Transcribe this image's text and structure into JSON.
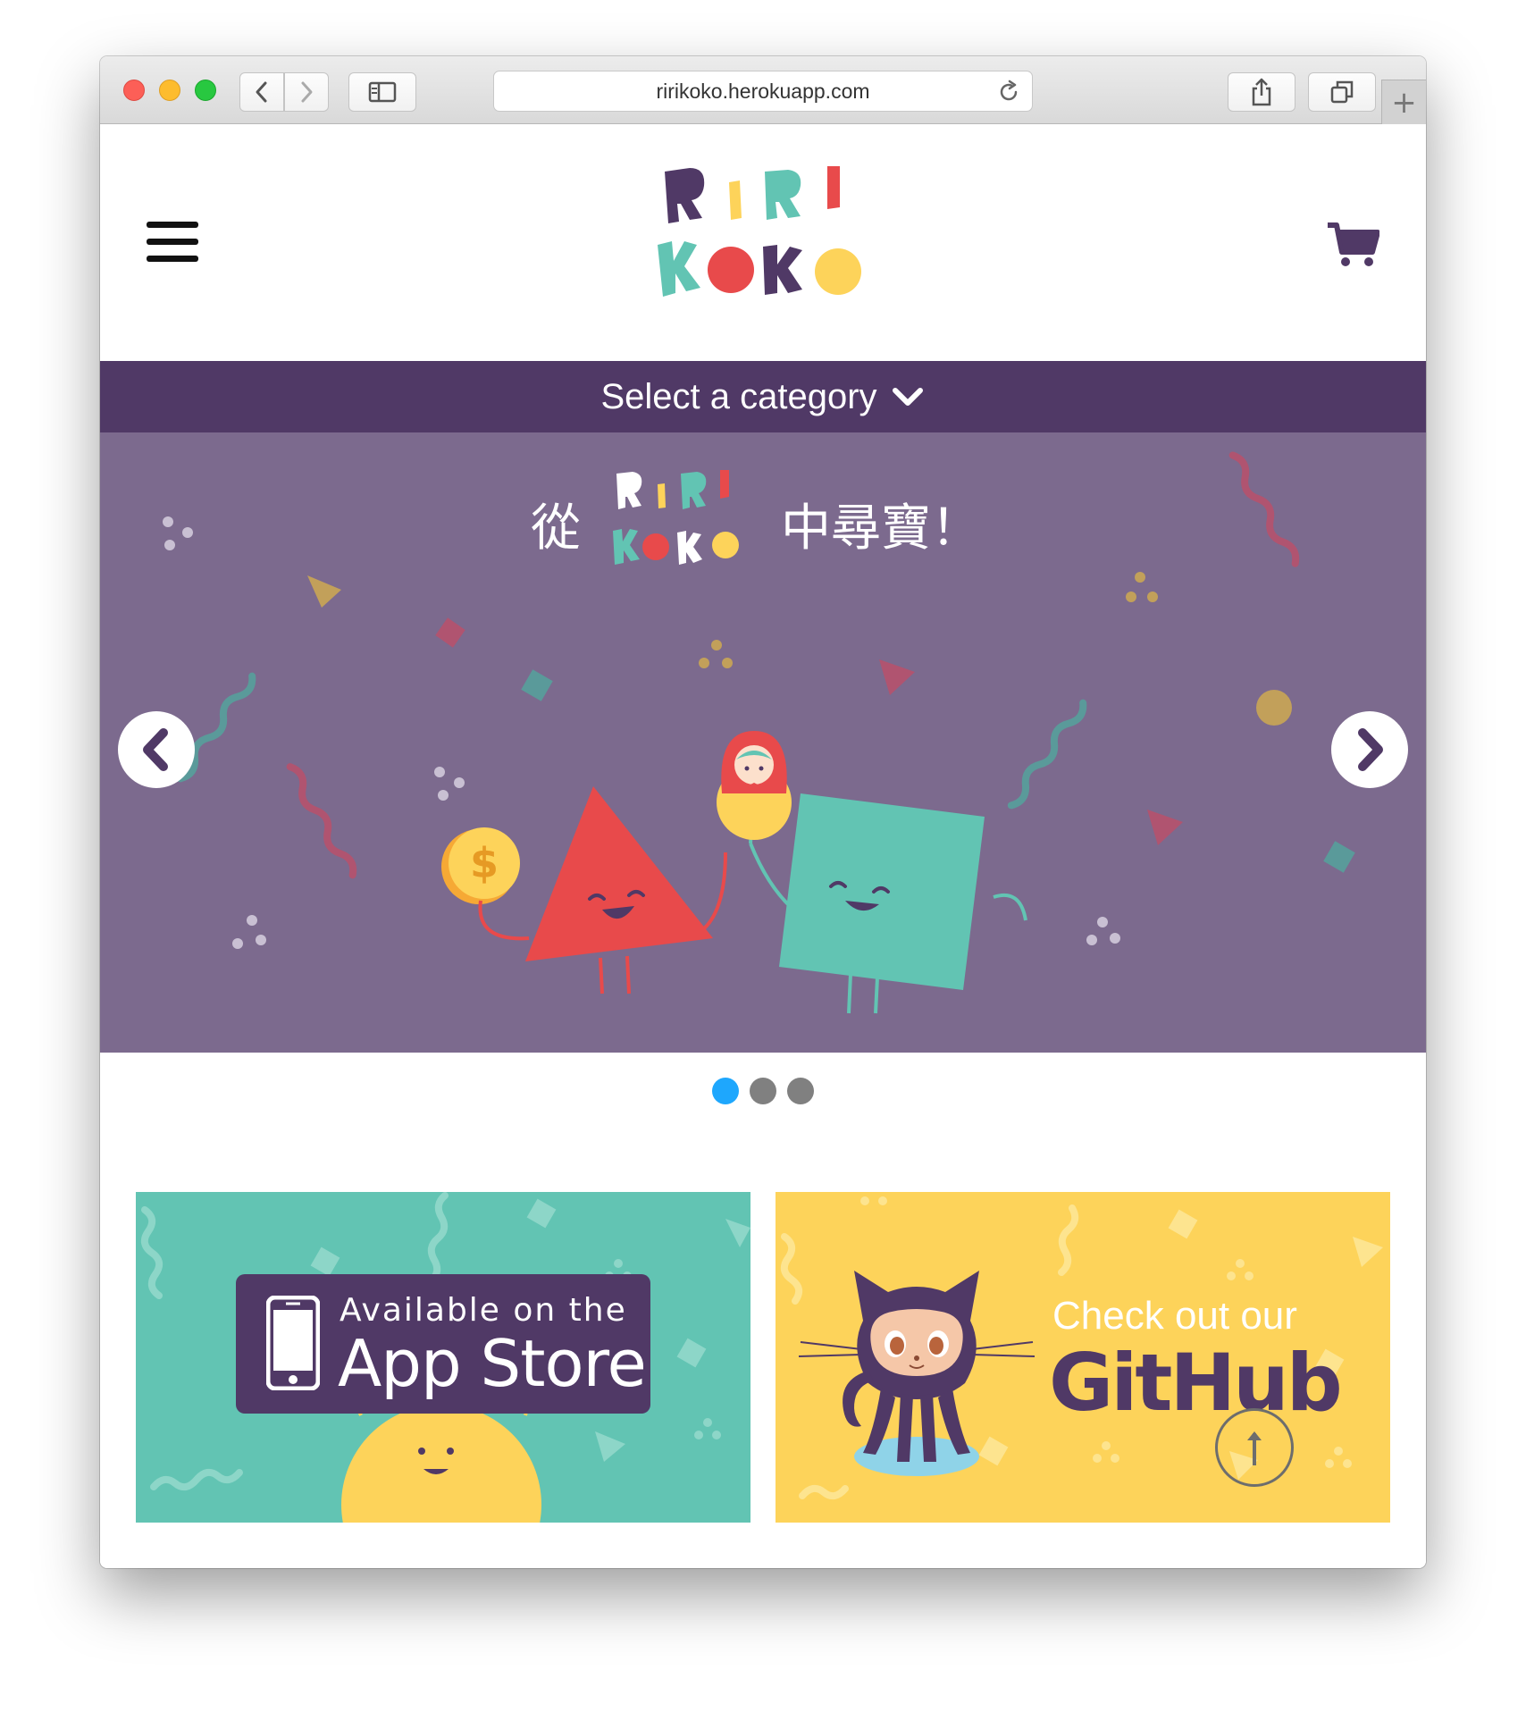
{
  "browser": {
    "url": "ririkoko.herokuapp.com",
    "new_tab_label": "+"
  },
  "header": {
    "logo_text": "RIRI KOKO"
  },
  "category_bar": {
    "label": "Select a category"
  },
  "hero": {
    "headline_before": "從",
    "headline_after": "中尋寶！",
    "slide_count": 3,
    "active_slide": 1
  },
  "promos": {
    "app_store": {
      "line1": "Available on the",
      "line2": "App Store"
    },
    "github": {
      "line1": "Check out our",
      "line2": "GitHub"
    }
  },
  "colors": {
    "brand_purple": "#503966",
    "hero_bg": "#7c6a8e",
    "teal": "#62c4b3",
    "yellow": "#fdd35a",
    "red": "#e84a4b",
    "dot_active": "#1ea7fd"
  }
}
